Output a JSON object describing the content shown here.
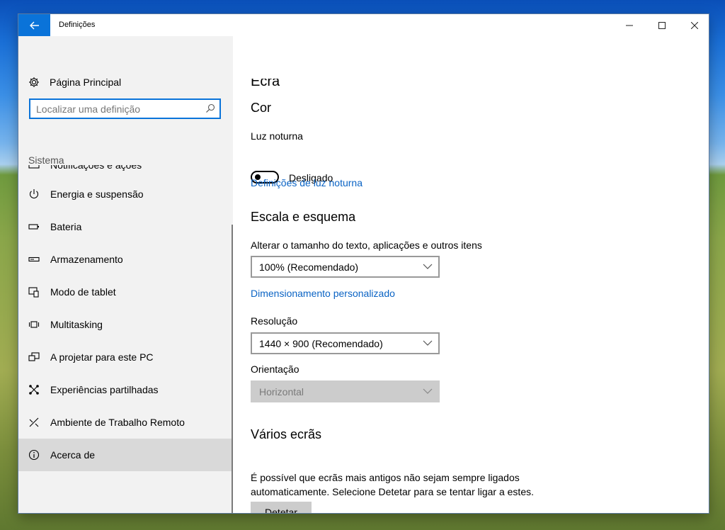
{
  "window": {
    "title": "Definições"
  },
  "sidebar": {
    "home_label": "Página Principal",
    "search_placeholder": "Localizar uma definição",
    "section_label": "Sistema",
    "clipped_item_label": "Notificações e ações",
    "items": [
      {
        "label": "Energia e suspensão",
        "icon": "power-icon"
      },
      {
        "label": "Bateria",
        "icon": "battery-icon"
      },
      {
        "label": "Armazenamento",
        "icon": "storage-icon"
      },
      {
        "label": "Modo de tablet",
        "icon": "tablet-mode-icon"
      },
      {
        "label": "Multitasking",
        "icon": "multitasking-icon"
      },
      {
        "label": "A projetar para este PC",
        "icon": "project-icon"
      },
      {
        "label": "Experiências partilhadas",
        "icon": "shared-experiences-icon"
      },
      {
        "label": "Ambiente de Trabalho Remoto",
        "icon": "remote-desktop-icon"
      },
      {
        "label": "Acerca de",
        "icon": "info-icon",
        "selected": true
      }
    ]
  },
  "main": {
    "title": "Ecrã",
    "color_section": {
      "heading": "Cor",
      "night_light_label": "Luz noturna",
      "night_light_state": "Desligado",
      "night_light_link": "Definições de luz noturna"
    },
    "scale_section": {
      "heading": "Escala e esquema",
      "scale_label": "Alterar o tamanho do texto, aplicações e outros itens",
      "scale_value": "100% (Recomendado)",
      "custom_scaling_link": "Dimensionamento personalizado",
      "resolution_label": "Resolução",
      "resolution_value": "1440 × 900 (Recomendado)",
      "orientation_label": "Orientação",
      "orientation_value": "Horizontal"
    },
    "multi_display_section": {
      "heading": "Vários ecrãs",
      "description": "É possível que ecrãs mais antigos não sejam sempre ligados automaticamente. Selecione Detetar para se tentar ligar a estes.",
      "detect_button": "Detetar"
    }
  },
  "colors": {
    "accent": "#0a73d9",
    "link": "#0a63c4",
    "selected_bg": "#d9d9d9",
    "sidebar_bg": "#f2f2f2"
  }
}
